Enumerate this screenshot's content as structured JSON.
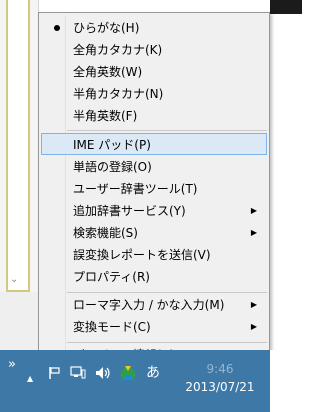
{
  "menu": {
    "items": [
      {
        "label": "ひらがな(H)",
        "checked": true
      },
      {
        "label": "全角カタカナ(K)"
      },
      {
        "label": "全角英数(W)"
      },
      {
        "label": "半角カタカナ(N)"
      },
      {
        "label": "半角英数(F)"
      },
      {
        "label": "IME パッド(P)",
        "highlighted": true
      },
      {
        "label": "単語の登録(O)"
      },
      {
        "label": "ユーザー辞書ツール(T)"
      },
      {
        "label": "追加辞書サービス(Y)",
        "submenu": true
      },
      {
        "label": "検索機能(S)",
        "submenu": true
      },
      {
        "label": "誤変換レポートを送信(V)"
      },
      {
        "label": "プロパティ(R)"
      },
      {
        "label": "ローマ字入力 / かな入力(M)",
        "submenu": true
      },
      {
        "label": "変換モード(C)",
        "submenu": true
      },
      {
        "label": "バージョン情報(A)"
      }
    ],
    "submenu_arrow": "▶"
  },
  "taskbar": {
    "overflow": "»",
    "flag_up": "▲",
    "ime_mode": "あ",
    "time": "9:46",
    "date": "2013/07/21"
  },
  "colors": {
    "menu_bg": "#f0f0f0",
    "highlight_bg": "#dbe9f7",
    "highlight_border": "#7eb4ea",
    "taskbar_bg": "#3d78a6"
  }
}
